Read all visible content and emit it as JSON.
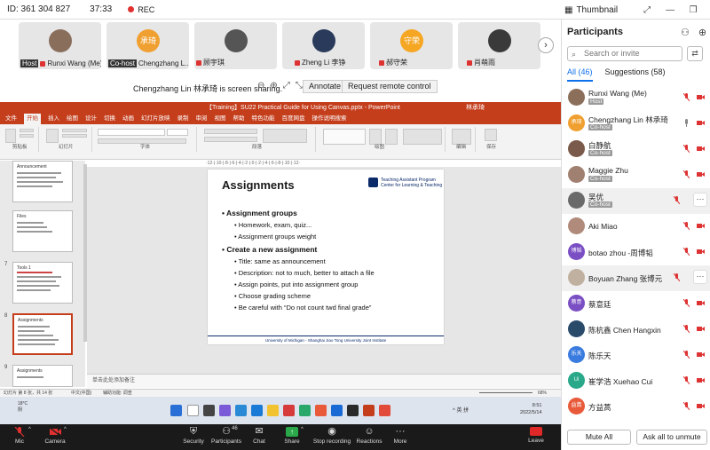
{
  "topbar": {
    "meeting_id": "ID: 361 304 827",
    "timer": "37:33",
    "rec_label": "REC",
    "view_label": "Thumbnail",
    "win_controls": [
      "⤢",
      "—",
      "❐",
      "✕"
    ]
  },
  "video_strip": {
    "tiles": [
      {
        "name": "Runxi Wang (Me)",
        "role": "Host",
        "initials": ""
      },
      {
        "name": "Chengzhang L...",
        "role": "Co-host",
        "initials": "承琦"
      },
      {
        "name": "顾宇琪",
        "role": "",
        "initials": ""
      },
      {
        "name": "Zheng Li 李铮",
        "role": "",
        "initials": ""
      },
      {
        "name": "郝守荣",
        "role": "",
        "initials": "守荣"
      },
      {
        "name": "肖萌雨",
        "role": "",
        "initials": ""
      }
    ],
    "next_icon": "›"
  },
  "share_bar": {
    "message": "Chengzhang Lin 林承琦 is screen sharing.",
    "zoom_controls": [
      "⊖",
      "⊕",
      "⤢",
      "⤡"
    ],
    "annotate_label": "Annotate",
    "remote_control_label": "Request remote control"
  },
  "powerpoint": {
    "window_title": "【Training】SU22 Practical Guide for Using Canvas.pptx - PowerPoint",
    "user": "林承琦",
    "menu": [
      "文件",
      "开始",
      "插入",
      "绘图",
      "设计",
      "切换",
      "动画",
      "幻灯片放映",
      "录制",
      "审阅",
      "视图",
      "帮助",
      "特色功能",
      "百度网盘",
      "操作说明搜索"
    ],
    "active_menu": "开始",
    "ribbon_groups": [
      "剪贴板",
      "幻灯片",
      "字体",
      "段落",
      "绘图",
      "编辑",
      "保存"
    ],
    "thumbnails": [
      {
        "num": "",
        "title": "Announcement"
      },
      {
        "num": "",
        "title": "Files"
      },
      {
        "num": "7",
        "title": "Tools 1"
      },
      {
        "num": "8",
        "title": "Assignments"
      },
      {
        "num": "9",
        "title": "Assignments"
      }
    ],
    "slide": {
      "title": "Assignments",
      "logo_line1": "Teaching Assistant Program",
      "logo_line2": "Center for Learning & Teaching",
      "bullets": [
        {
          "level": 1,
          "text": "Assignment groups"
        },
        {
          "level": 2,
          "text": "Homework, exam, quiz..."
        },
        {
          "level": 2,
          "text": "Assignment groups weight"
        },
        {
          "level": 1,
          "text": "Create a new assignment"
        },
        {
          "level": 2,
          "text": "Title: same as announcement"
        },
        {
          "level": 2,
          "text": "Description: not to much, better to attach a file"
        },
        {
          "level": 2,
          "text": "Assign points, put into assignment group"
        },
        {
          "level": 2,
          "text": "Choose grading scheme"
        },
        {
          "level": 2,
          "text": "Be careful with “Do not count twd final grade”"
        }
      ],
      "footer": "University of Michigan - Shanghai Jiao Tong University Joint Institute"
    },
    "notes_placeholder": "单击此处添加备注",
    "status_left": "幻灯片 第 8 张，共 14 张",
    "status_lang": "中文(中国)",
    "status_access": "辅助功能: 调查",
    "zoom": "68%",
    "ruler": "·12·|·10·|·8·|·6·|·4·|·2·|·0·|·2·|·4·|·6·|·8·|·10·|·12·",
    "taskbar": {
      "weather_temp": "18°C",
      "weather_desc": "阴",
      "tray": "^ 英 拼",
      "time": "8:51",
      "date": "2022/5/14"
    }
  },
  "participants": {
    "title": "Participants",
    "search_placeholder": "Search or invite",
    "tab_all": "All (46)",
    "tab_suggestions": "Suggestions (58)",
    "list": [
      {
        "name": "Runxi Wang (Me)",
        "role": "Host",
        "initials": "",
        "color": "#8b6f5a"
      },
      {
        "name": "Chengzhang Lin 林承琦",
        "role": "Co-host",
        "initials": "承琦",
        "color": "#f0a030"
      },
      {
        "name": "白静航",
        "role": "Co-host",
        "initials": "",
        "color": "#7a5a4a"
      },
      {
        "name": "Maggie Zhu",
        "role": "Co-host",
        "initials": "",
        "color": "#a08070"
      },
      {
        "name": "吴优",
        "role": "Co-host",
        "initials": "",
        "color": "#6a6a6a"
      },
      {
        "name": "Aki Miao",
        "role": "",
        "initials": "",
        "color": "#b08a7a"
      },
      {
        "name": "botao zhou -周博韬",
        "role": "",
        "initials": "博韬",
        "color": "#7b4fc4"
      },
      {
        "name": "Boyuan Zhang 张博元",
        "role": "",
        "initials": "",
        "color": "#c0b0a0"
      },
      {
        "name": "蔡意廷",
        "role": "",
        "initials": "蔡意",
        "color": "#7b4fc4"
      },
      {
        "name": "陈杭鑫 Chen Hangxin",
        "role": "",
        "initials": "",
        "color": "#2a4a6a"
      },
      {
        "name": "陈乐天",
        "role": "",
        "initials": "乐天",
        "color": "#3a7be0"
      },
      {
        "name": "崔学浩 Xuehao Cui",
        "role": "",
        "initials": "Ui",
        "color": "#2aa88a"
      },
      {
        "name": "方益蒿",
        "role": "",
        "initials": "益蒿",
        "color": "#e85a3a"
      },
      {
        "name": "宫雨",
        "role": "",
        "initials": "",
        "color": "#e85a3a"
      }
    ],
    "mute_all": "Mute All",
    "ask_unmute": "Ask all to unmute"
  },
  "toolbar": {
    "mic": "Mic",
    "camera": "Camera",
    "security": "Security",
    "participants": "Participants",
    "participants_count": "46",
    "chat": "Chat",
    "share": "Share",
    "stop_recording": "Stop recording",
    "reactions": "Reactions",
    "more": "More",
    "leave": "Leave"
  },
  "colors": {
    "accent": "#0e71eb",
    "ppt_red": "#c43e1c",
    "muted_red": "#d33333",
    "leave_red": "#e02828"
  }
}
